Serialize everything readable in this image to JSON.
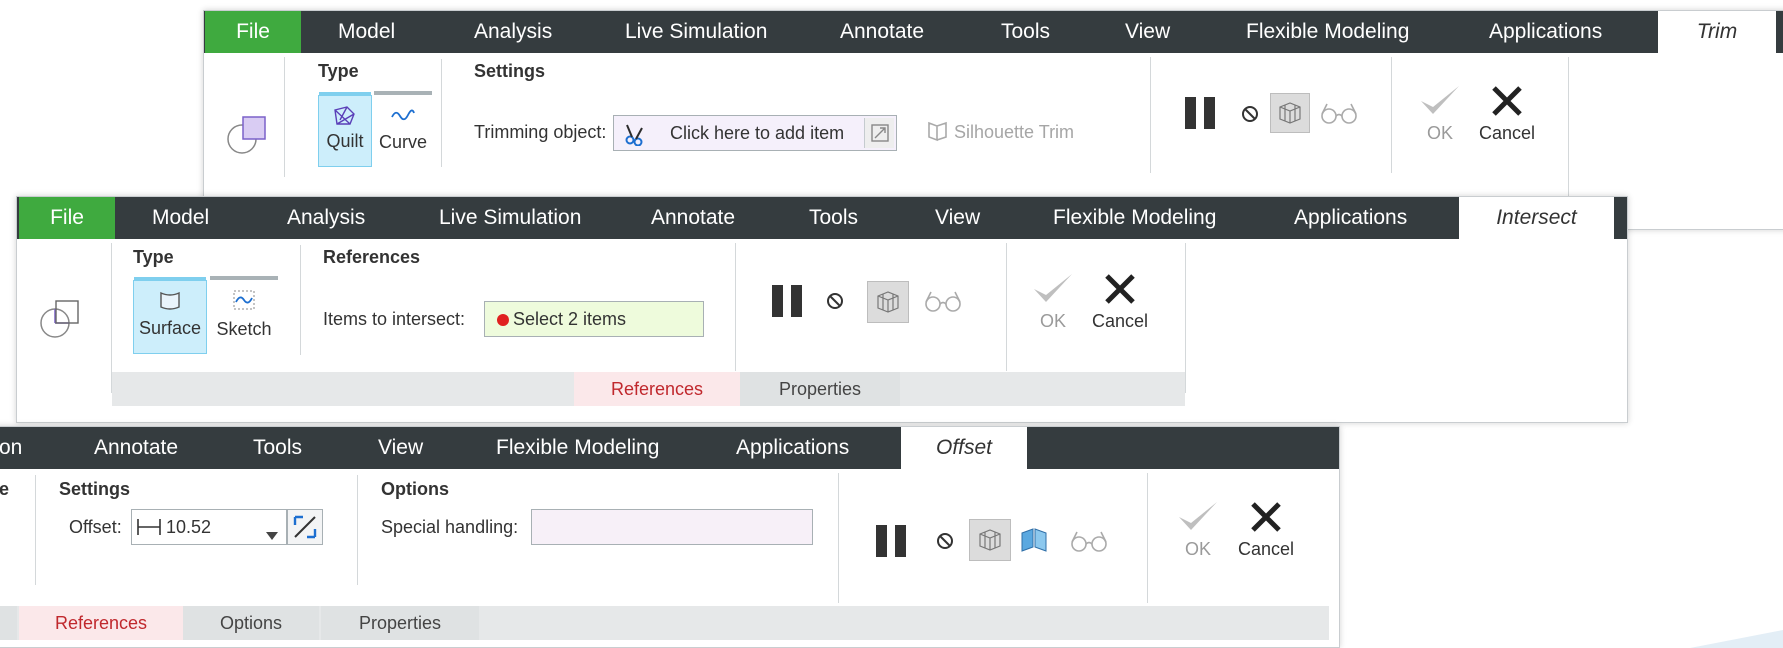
{
  "colors": {
    "menubar": "#353c3f",
    "file_tab": "#3faa3f",
    "selected": "#cdeefb",
    "active_tab_text": "#c0282d",
    "input_green": "#eefbdc"
  },
  "trim": {
    "menu": {
      "file": "File",
      "items": [
        "Model",
        "Analysis",
        "Live Simulation",
        "Annotate",
        "Tools",
        "View",
        "Flexible Modeling",
        "Applications"
      ],
      "context": "Trim"
    },
    "type_title": "Type",
    "types": [
      {
        "label": "Quilt",
        "icon": "quilt-icon",
        "selected": true
      },
      {
        "label": "Curve",
        "icon": "curve-icon",
        "selected": false
      }
    ],
    "settings_title": "Settings",
    "trimming_label": "Trimming object:",
    "trimming_placeholder": "Click here to add item",
    "silhouette_label": "Silhouette Trim",
    "ok": "OK",
    "cancel": "Cancel"
  },
  "intersect": {
    "menu": {
      "file": "File",
      "items": [
        "Model",
        "Analysis",
        "Live Simulation",
        "Annotate",
        "Tools",
        "View",
        "Flexible Modeling",
        "Applications"
      ],
      "context": "Intersect"
    },
    "type_title": "Type",
    "types": [
      {
        "label": "Surface",
        "icon": "surface-icon",
        "selected": true
      },
      {
        "label": "Sketch",
        "icon": "sketch-icon",
        "selected": false
      }
    ],
    "references_title": "References",
    "items_label": "Items to intersect:",
    "items_value": "Select 2 items",
    "ok": "OK",
    "cancel": "Cancel",
    "tabs": [
      {
        "label": "References",
        "active": true
      },
      {
        "label": "Properties",
        "active": false
      }
    ]
  },
  "offset": {
    "menu": {
      "partial": "on",
      "items": [
        "Annotate",
        "Tools",
        "View",
        "Flexible Modeling",
        "Applications"
      ],
      "context": "Offset"
    },
    "partial_group": "e",
    "settings_title": "Settings",
    "offset_label": "Offset:",
    "offset_value": "10.52",
    "options_title": "Options",
    "special_label": "Special handling:",
    "special_value": "",
    "ok": "OK",
    "cancel": "Cancel",
    "tabs": [
      {
        "label": "References",
        "active": true
      },
      {
        "label": "Options",
        "active": false
      },
      {
        "label": "Properties",
        "active": false
      }
    ]
  }
}
